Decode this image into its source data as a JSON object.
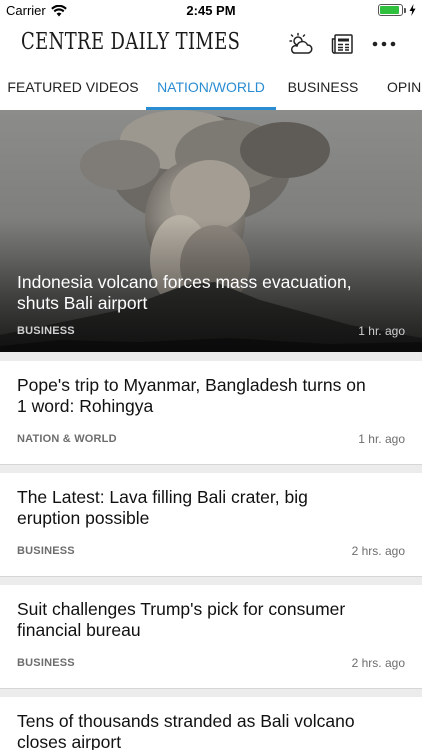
{
  "status_bar": {
    "carrier": "Carrier",
    "time": "2:45 PM",
    "battery_level": 0.92
  },
  "header": {
    "logo": "CENTRE DAILY TIMES",
    "icons": [
      "weather-icon",
      "epaper-icon",
      "more-icon"
    ]
  },
  "tabs": [
    {
      "label": "FEATURED VIDEOS",
      "active": false
    },
    {
      "label": "NATION/WORLD",
      "active": true
    },
    {
      "label": "BUSINESS",
      "active": false
    },
    {
      "label": "OPINI",
      "active": false
    }
  ],
  "hero": {
    "title": "Indonesia volcano forces mass evacuation, shuts Bali airport",
    "section": "BUSINESS",
    "time": "1 hr. ago"
  },
  "articles": [
    {
      "title": "Pope's trip to Myanmar, Bangladesh turns on 1 word: Rohingya",
      "section": "NATION & WORLD",
      "time": "1 hr. ago"
    },
    {
      "title": "The Latest: Lava filling Bali crater, big eruption possible",
      "section": "BUSINESS",
      "time": "2 hrs. ago"
    },
    {
      "title": "Suit challenges Trump's pick for consumer financial bureau",
      "section": "BUSINESS",
      "time": "2 hrs. ago"
    },
    {
      "title": "Tens of thousands stranded as Bali volcano closes airport",
      "section": "",
      "time": ""
    }
  ],
  "colors": {
    "accent": "#2b8dd1",
    "battery": "#2fc13d"
  }
}
